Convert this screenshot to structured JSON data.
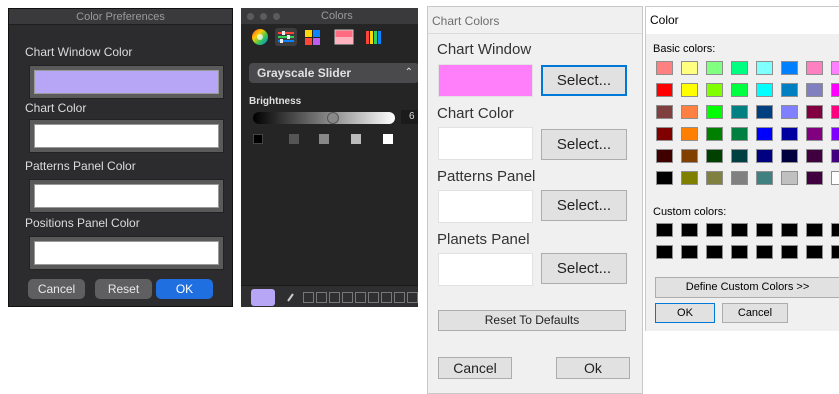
{
  "mac_prefs": {
    "title": "Color Preferences",
    "fields": [
      {
        "label": "Chart Window Color",
        "color": "#b6a6f5"
      },
      {
        "label": "Chart Color",
        "color": "#ffffff"
      },
      {
        "label": "Patterns Panel Color",
        "color": "#ffffff"
      },
      {
        "label": "Positions Panel Color",
        "color": "#ffffff"
      }
    ],
    "cancel_label": "Cancel",
    "reset_label": "Reset",
    "ok_label": "OK"
  },
  "mac_colors": {
    "title": "Colors",
    "mode_label": "Grayscale Slider",
    "mode_arrow": "⌃",
    "brightness_label": "Brightness",
    "brightness_value": "6",
    "current_color": "#b6a6f5"
  },
  "win_chart": {
    "title": "Chart Colors",
    "fields": [
      {
        "label": "Chart Window",
        "color": "#ff7ffa",
        "button": "Select..."
      },
      {
        "label": "Chart Color",
        "color": "#ffffff",
        "button": "Select..."
      },
      {
        "label": "Patterns Panel",
        "color": "#ffffff",
        "button": "Select..."
      },
      {
        "label": "Planets Panel",
        "color": "#ffffff",
        "button": "Select..."
      }
    ],
    "reset_label": "Reset To Defaults",
    "cancel_label": "Cancel",
    "ok_label": "Ok"
  },
  "win_color": {
    "title": "Color",
    "basic_label": "Basic colors:",
    "custom_label": "Custom colors:",
    "define_label": "Define Custom Colors >>",
    "ok_label": "OK",
    "cancel_label": "Cancel",
    "basic_colors": [
      [
        "#ff8080",
        "#ffff80",
        "#80ff80",
        "#00ff80",
        "#80ffff",
        "#0080ff",
        "#ff80c0",
        "#ff80ff"
      ],
      [
        "#ff0000",
        "#ffff00",
        "#80ff00",
        "#00ff40",
        "#00ffff",
        "#0080c0",
        "#8080c0",
        "#ff00ff"
      ],
      [
        "#804040",
        "#ff8040",
        "#00ff00",
        "#008080",
        "#004080",
        "#8080ff",
        "#800040",
        "#ff0080"
      ],
      [
        "#800000",
        "#ff8000",
        "#008000",
        "#008040",
        "#0000ff",
        "#0000a0",
        "#800080",
        "#8000ff"
      ],
      [
        "#400000",
        "#804000",
        "#004000",
        "#004040",
        "#000080",
        "#000040",
        "#400040",
        "#400080"
      ],
      [
        "#000000",
        "#808000",
        "#808040",
        "#808080",
        "#408080",
        "#c0c0c0",
        "#400040",
        "#ffffff"
      ]
    ]
  }
}
